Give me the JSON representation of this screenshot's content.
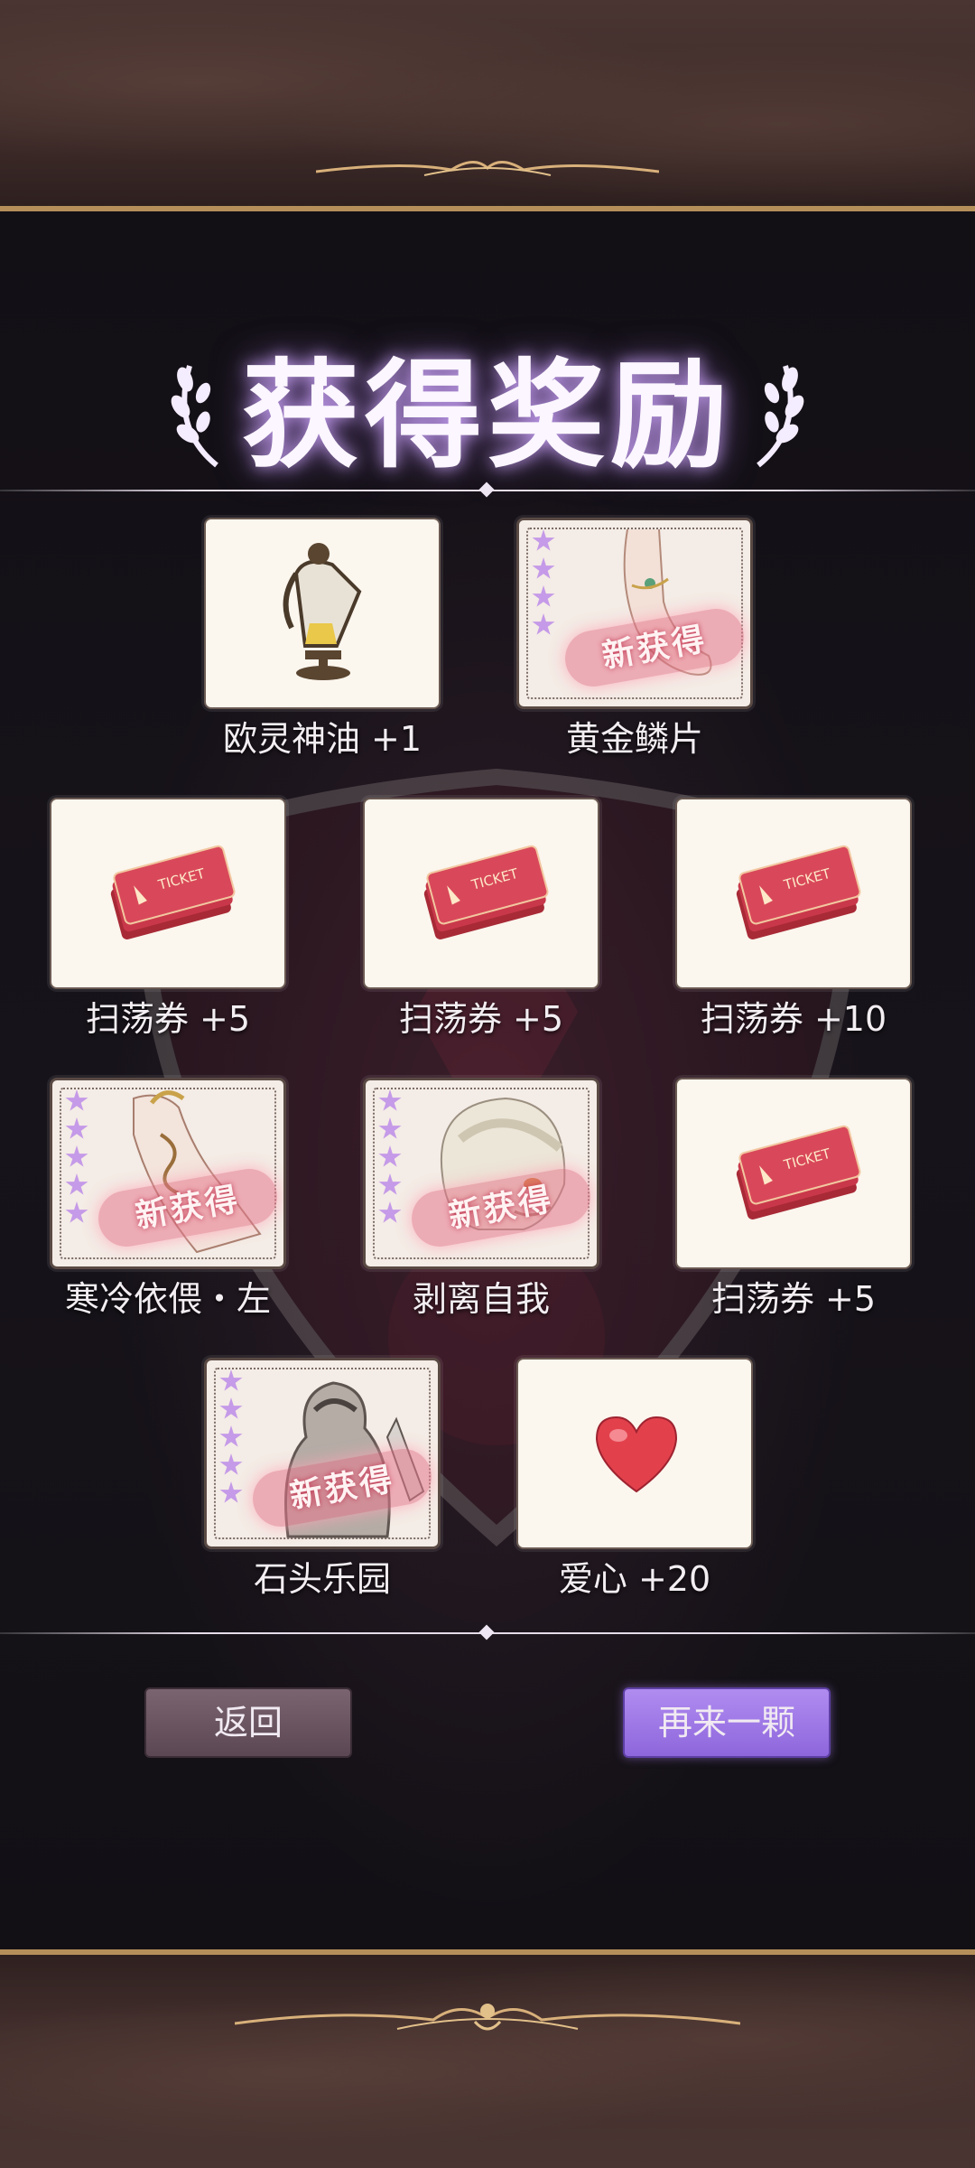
{
  "screen": {
    "title": "获得奖励",
    "accent_color": "#a982ea",
    "frame_color": "#b58f5a"
  },
  "rewards": [
    {
      "label": "欧灵神油 +1",
      "icon": "oil-lamp-icon",
      "new": false
    },
    {
      "label": "黄金鳞片",
      "icon": "golden-scale-card-art",
      "new": true,
      "new_label": "新获得",
      "stars": 4
    },
    {
      "label": "扫荡券 +5",
      "icon": "ticket-icon",
      "new": false
    },
    {
      "label": "扫荡券 +5",
      "icon": "ticket-icon",
      "new": false
    },
    {
      "label": "扫荡券 +10",
      "icon": "ticket-icon",
      "new": false
    },
    {
      "label": "寒冷依偎・左",
      "icon": "cold-embrace-card-art",
      "new": true,
      "new_label": "新获得",
      "stars": 5
    },
    {
      "label": "剥离自我",
      "icon": "peel-self-card-art",
      "new": true,
      "new_label": "新获得",
      "stars": 5
    },
    {
      "label": "扫荡券 +5",
      "icon": "ticket-icon",
      "new": false
    },
    {
      "label": "石头乐园",
      "icon": "stone-paradise-card-art",
      "new": true,
      "new_label": "新获得",
      "stars": 5
    },
    {
      "label": "爱心 +20",
      "icon": "heart-icon",
      "new": false
    }
  ],
  "buttons": {
    "back": "返回",
    "again": "再来一颗"
  }
}
